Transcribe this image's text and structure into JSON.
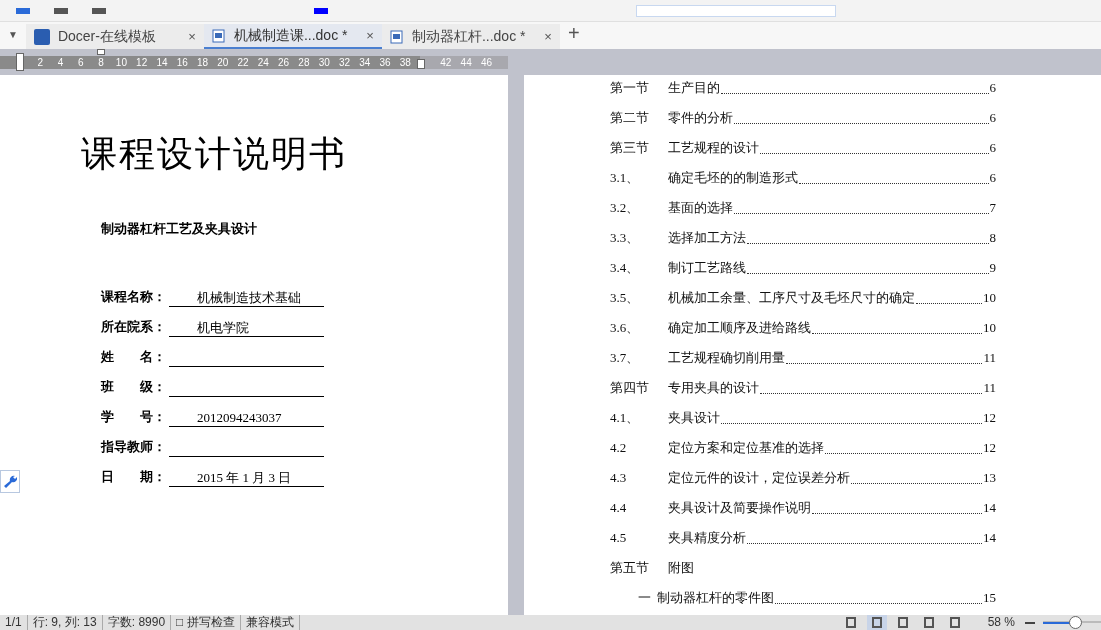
{
  "tab_list_button": "▼",
  "tabs": [
    {
      "label": "Docer-在线模板",
      "kind": "docer",
      "selected": false,
      "close": "×"
    },
    {
      "label": "机械制造课...doc *",
      "kind": "doc",
      "selected": true,
      "close": "×"
    },
    {
      "label": "制动器杠杆...doc *",
      "kind": "doc",
      "selected": false,
      "close": "×"
    }
  ],
  "new_tab_button": "+",
  "ruler": {
    "ticks": [
      "2",
      "4",
      "6",
      "8",
      "10",
      "12",
      "14",
      "16",
      "18",
      "20",
      "22",
      "24",
      "26",
      "28",
      "30",
      "32",
      "34",
      "36",
      "38",
      "42",
      "44",
      "46"
    ]
  },
  "cover": {
    "title": "课程设计说明书",
    "subtitle": "制动器杠杆工艺及夹具设计",
    "fields": [
      {
        "label": "课程名称：",
        "value": "机械制造技术基础"
      },
      {
        "label": "所在院系：",
        "value": "机电学院"
      },
      {
        "label": "姓　　名："
      },
      {
        "label": "班　　级："
      },
      {
        "label": "学　　号：",
        "value": "2012094243037"
      },
      {
        "label": "指导教师："
      },
      {
        "label": "日　　期：",
        "value": "2015 年 1 月 3 日"
      }
    ]
  },
  "toc": [
    {
      "number": "第一节",
      "title": "生产目的",
      "page": "6"
    },
    {
      "number": "第二节",
      "title": "零件的分析",
      "page": "6"
    },
    {
      "number": "第三节",
      "title": "工艺规程的设计",
      "page": "6"
    },
    {
      "number": "3.1、",
      "title": "确定毛坯的的制造形式",
      "page": "6"
    },
    {
      "number": "3.2、",
      "title": "基面的选择",
      "page": "7"
    },
    {
      "number": "3.3、",
      "title": "选择加工方法",
      "page": "8"
    },
    {
      "number": "3.4、",
      "title": "制订工艺路线",
      "page": "9"
    },
    {
      "number": "3.5、",
      "title": "机械加工余量、工序尺寸及毛坯尺寸的确定",
      "page": "10"
    },
    {
      "number": "3.6、",
      "title": "确定加工顺序及进给路线",
      "page": "10"
    },
    {
      "number": "3.7、",
      "title": "工艺规程确切削用量",
      "page": "11"
    },
    {
      "number": "第四节",
      "title": "专用夹具的设计",
      "page": "11"
    },
    {
      "number": "4.1、",
      "title": "夹具设计",
      "page": "12"
    },
    {
      "number": "4.2",
      "title": "定位方案和定位基准的选择",
      "page": "12"
    },
    {
      "number": "4.3",
      "title": "定位元件的设计，定位误差分析",
      "page": "13"
    },
    {
      "number": "4.4",
      "title": "夹具设计及简要操作说明",
      "page": "14"
    },
    {
      "number": "4.5",
      "title": "夹具精度分析",
      "page": "14"
    },
    {
      "number": "第五节",
      "title": "附图"
    },
    {
      "number": "一",
      "title": "制动器杠杆的零件图",
      "page": "15"
    }
  ],
  "status_bar": {
    "items": [
      "1/1",
      "行: 9, 列: 13",
      "字数: 8990",
      "□ 拼写检查",
      "兼容模式"
    ],
    "zoom": "58 %",
    "zoom_slider": {
      "level": 0.55
    }
  }
}
